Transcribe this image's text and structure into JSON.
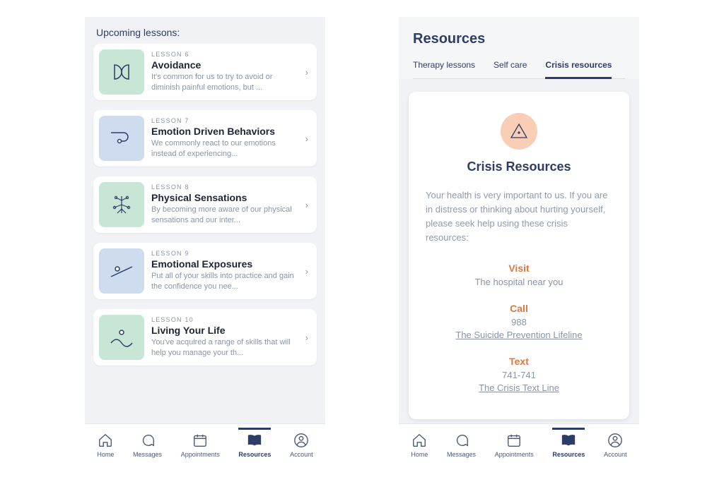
{
  "left": {
    "section_title": "Upcoming lessons:",
    "lessons": [
      {
        "tag": "LESSON 6",
        "title": "Avoidance",
        "desc": "It's common for us to try to avoid or diminish painful emotions, but ...",
        "icon_color": "#c7e6d6"
      },
      {
        "tag": "LESSON 7",
        "title": "Emotion Driven Behaviors",
        "desc": "We commonly react to our emotions instead of experiencing...",
        "icon_color": "#cfdcf0"
      },
      {
        "tag": "LESSON 8",
        "title": "Physical Sensations",
        "desc": "By becoming more aware of our physical sensations and our inter...",
        "icon_color": "#c7e6d6"
      },
      {
        "tag": "LESSON 9",
        "title": "Emotional Exposures",
        "desc": "Put all of your skills into practice and gain the confidence you nee...",
        "icon_color": "#cfdcf0"
      },
      {
        "tag": "LESSON 10",
        "title": "Living Your Life",
        "desc": "You've acquired a range of skills that will help you manage your th...",
        "icon_color": "#c7e6d6"
      }
    ]
  },
  "right": {
    "heading": "Resources",
    "tabs": [
      {
        "label": "Therapy lessons",
        "active": false
      },
      {
        "label": "Self care",
        "active": false
      },
      {
        "label": "Crisis resources",
        "active": true
      }
    ],
    "crisis": {
      "title": "Crisis Resources",
      "intro": "Your health is very important to us. If you are in distress or thinking about hurting yourself, please seek help using these crisis resources:",
      "visit_label": "Visit",
      "visit_value": "The hospital near you",
      "call_label": "Call",
      "call_number": "988",
      "call_link": "The Suicide Prevention Lifeline",
      "text_label": "Text",
      "text_number": "741-741",
      "text_link": "The Crisis Text Line"
    }
  },
  "nav": {
    "home": "Home",
    "messages": "Messages",
    "appointments": "Appointments",
    "resources": "Resources",
    "account": "Account"
  }
}
